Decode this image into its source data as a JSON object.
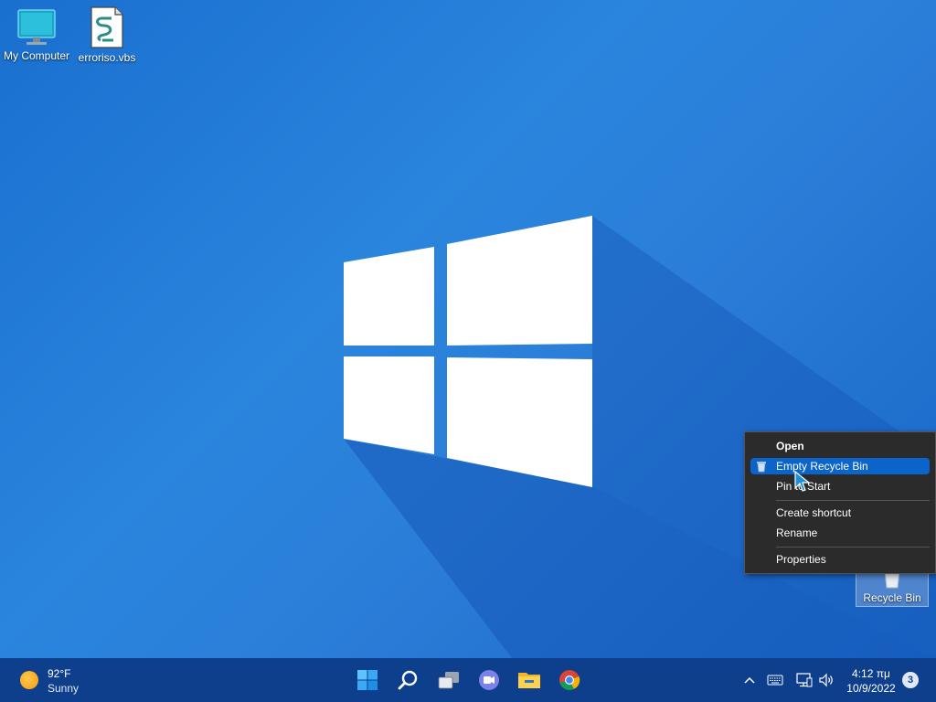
{
  "desktop": {
    "icons": {
      "my_computer": "My Computer",
      "vbs_file": "erroriso.vbs",
      "recycle_bin": "Recycle Bin"
    }
  },
  "context_menu": {
    "items": [
      {
        "label": "Open",
        "bold": true
      },
      {
        "label": "Empty Recycle Bin",
        "highlighted": true
      },
      {
        "label": "Pin to Start"
      },
      {
        "label": "Create shortcut"
      },
      {
        "label": "Rename"
      },
      {
        "label": "Properties"
      }
    ]
  },
  "taskbar": {
    "weather": {
      "temp": "92°F",
      "condition": "Sunny",
      "icon": "sun-icon"
    },
    "apps": [
      "start-icon",
      "search-icon",
      "task-view-icon",
      "chat-icon",
      "file-explorer-icon",
      "chrome-icon"
    ],
    "tray": {
      "icons": [
        "chevron-up-icon",
        "keyboard-icon",
        "network-icon",
        "volume-icon"
      ],
      "time": "4:12 πμ",
      "date": "10/9/2022",
      "notifications": "3"
    }
  },
  "colors": {
    "desktop_blue": "#2a85dd",
    "taskbar": "#0e3f8c",
    "menu_bg": "#2b2b2b",
    "menu_highlight": "#0a64c9"
  }
}
